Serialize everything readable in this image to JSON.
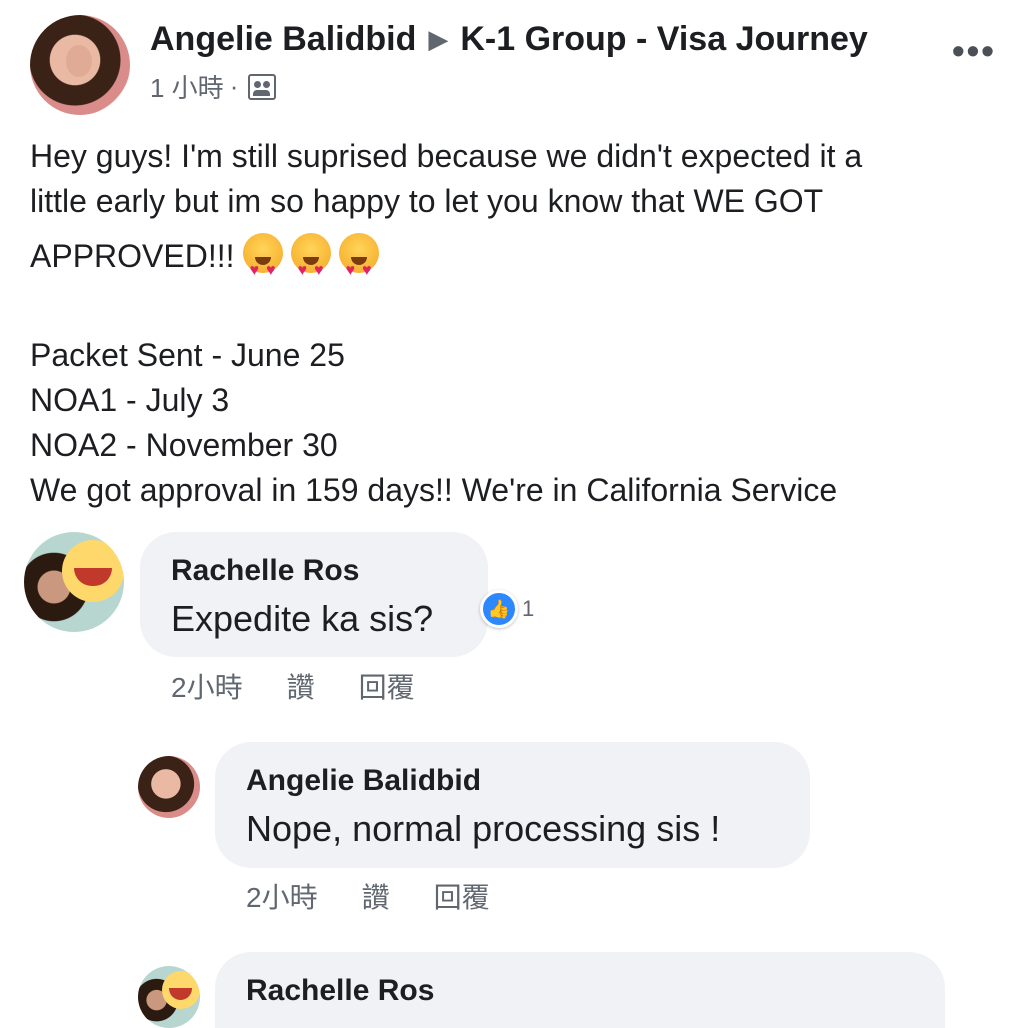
{
  "post": {
    "author": "Angelie Balidbid",
    "arrow": "▶",
    "group": "K-1 Group - Visa Journey",
    "time": "1 小時",
    "separator": "·",
    "more": "•••",
    "body_lines": [
      "Hey guys! I'm still suprised because we didn't expected it a",
      "little early but im so happy to let you know that WE GOT",
      "APPROVED!!!",
      "",
      "Packet Sent - June 25",
      "NOA1 - July 3",
      "NOA2 - November 30",
      "We got approval in 159 days!! We're in California Service"
    ]
  },
  "comments": [
    {
      "author": "Rachelle Ros",
      "text": "Expedite ka sis?",
      "time": "2小時",
      "like_label": "讚",
      "reply_label": "回覆",
      "reaction_count": "1"
    },
    {
      "author": "Angelie Balidbid",
      "text": "Nope, normal processing sis !",
      "time": "2小時",
      "like_label": "讚",
      "reply_label": "回覆"
    },
    {
      "author": "Rachelle Ros"
    }
  ],
  "colors": {
    "bubble": "#f0f2f5",
    "meta_text": "#606770",
    "like_blue": "#2d88ff"
  }
}
